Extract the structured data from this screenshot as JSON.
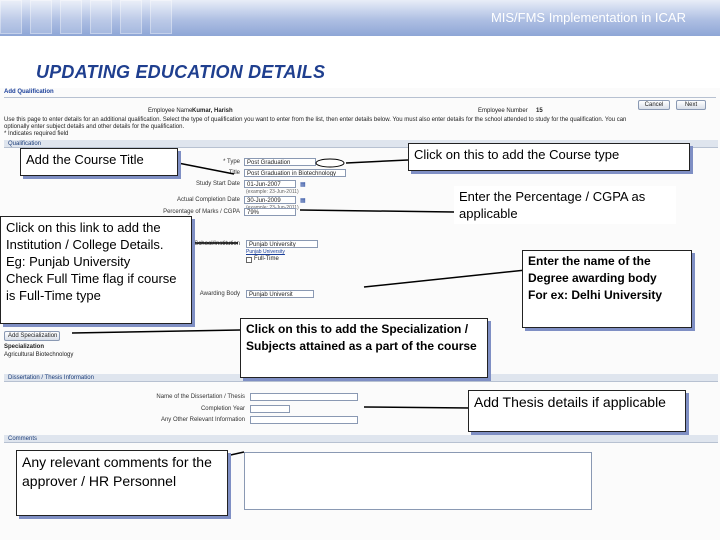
{
  "header": {
    "title": "MIS/FMS Implementation in ICAR"
  },
  "slide": {
    "title": "UPDATING EDUCATION DETAILS"
  },
  "app": {
    "page_title": "Add Qualification",
    "employee_name_label": "Employee Name",
    "employee_name_value": "Kumar, Harish",
    "employee_number_label": "Employee Number",
    "employee_number_value": "15",
    "cancel_label": "Cancel",
    "next_label": "Next",
    "instructions_line1": "Use this page to enter details for an additional qualification. Select the type of qualification you want to enter from the list, then enter details below. You must also enter details for the school attended to study for the qualification. You can",
    "instructions_line2": "optionally enter subject details and other details for the qualification.",
    "required_note": "* Indicates required field",
    "qualification_section": "Qualification",
    "type_label": "* Type",
    "type_value": "Post Graduation",
    "title_label": "Title",
    "title_value": "Post Graduation in Biotechnology",
    "study_start_label": "Study Start Date",
    "study_start_value": "01-Jun-2007",
    "study_start_hint": "(example: 23-Jun-2011)",
    "completion_label": "Actual Completion Date",
    "completion_value": "30-Jun-2009",
    "completion_hint": "(example: 23-Jun-2011)",
    "percentage_label": "Percentage of Marks / CGPA",
    "percentage_value": "79%",
    "institution_label": "School/Institution",
    "institution_value": "Punjab University",
    "full_time_label": "Full-Time",
    "awarding_label": "Awarding Body",
    "awarding_value": "Punjab Universit",
    "add_specialization_label": "Add Specialization",
    "specialization_header": "Specialization",
    "specialization_value": "Agricultural Biotechnology",
    "dissertation_section": "Dissertation / Thesis Information",
    "dissertation_name_label": "Name of the Dissertation / Thesis",
    "completion_year_label": "Completion Year",
    "other_info_label": "Any Other Relevant Information",
    "comments_section": "Comments"
  },
  "callouts": {
    "course_title": "Add the Course Title",
    "course_type": "Click on this to add the Course type",
    "percentage": "Enter the Percentage / CGPA as applicable",
    "institution": "Click on this link to add the Institution / College Details. Eg: Punjab University\nCheck Full Time flag if course is Full-Time type",
    "degree_body": "Enter the name of the Degree awarding body\nFor ex: Delhi University",
    "specialization": "Click on this to add the Specialization / Subjects attained as a part of the course",
    "thesis": "Add Thesis details if applicable",
    "comments": "Any relevant comments for the approver / HR Personnel"
  },
  "colors": {
    "header_start": "#e8edf8",
    "header_end": "#8ea6d6",
    "slide_title": "#1f3f8f",
    "callout_shadow": "#7f8fc4"
  }
}
